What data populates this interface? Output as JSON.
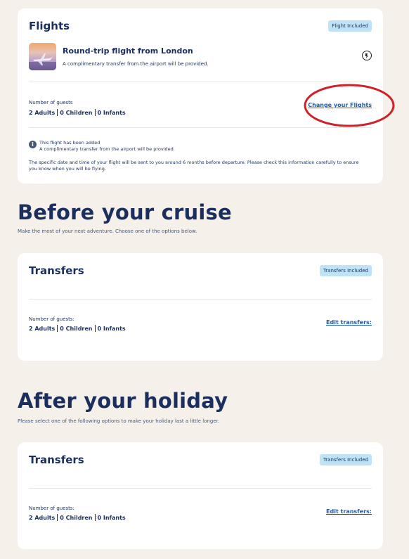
{
  "flights": {
    "title": "Flights",
    "badge": "Flight Included",
    "route_title": "Round-trip flight from London",
    "route_sub": "A complimentary transfer from the airport will be provided.",
    "guests_label": "Number of guests",
    "adults": "2 Adults",
    "children": "0 Children",
    "infants": "0 Infants",
    "change_link": "Change your Flights",
    "notice_line1": "This flight has been added",
    "notice_line2": "A complimentary transfer from the airport will be provided.",
    "disclaimer": "The specific date and time of your flight will be sent to you around 6 months before departure. Please check this information carefully to ensure you know when you will be flying.",
    "airline_icon": "airline-logo-icon",
    "info_icon": "info-icon"
  },
  "before": {
    "heading": "Before your cruise",
    "sub": "Make the most of your next adventure. Choose one of the options below.",
    "card": {
      "title": "Transfers",
      "badge": "Transfers Included",
      "guests_label": "Number of guests:",
      "adults": "2 Adults",
      "children": "0 Children",
      "infants": "0 Infants",
      "edit_link": "Edit transfers:"
    }
  },
  "after": {
    "heading": "After your holiday",
    "sub": "Please select one of the following options to make your holiday last a little longer.",
    "card": {
      "title": "Transfers",
      "badge": "Transfers Included",
      "guests_label": "Number of guests:",
      "adults": "2 Adults",
      "children": "0 Children",
      "infants": "0 Infants",
      "edit_link": "Edit transfers:"
    }
  },
  "colors": {
    "background": "#f5f0ea",
    "navy": "#1b2f5e",
    "badge": "#bfe3f6",
    "link": "#1f5aa8",
    "annotation": "#d0202a"
  }
}
